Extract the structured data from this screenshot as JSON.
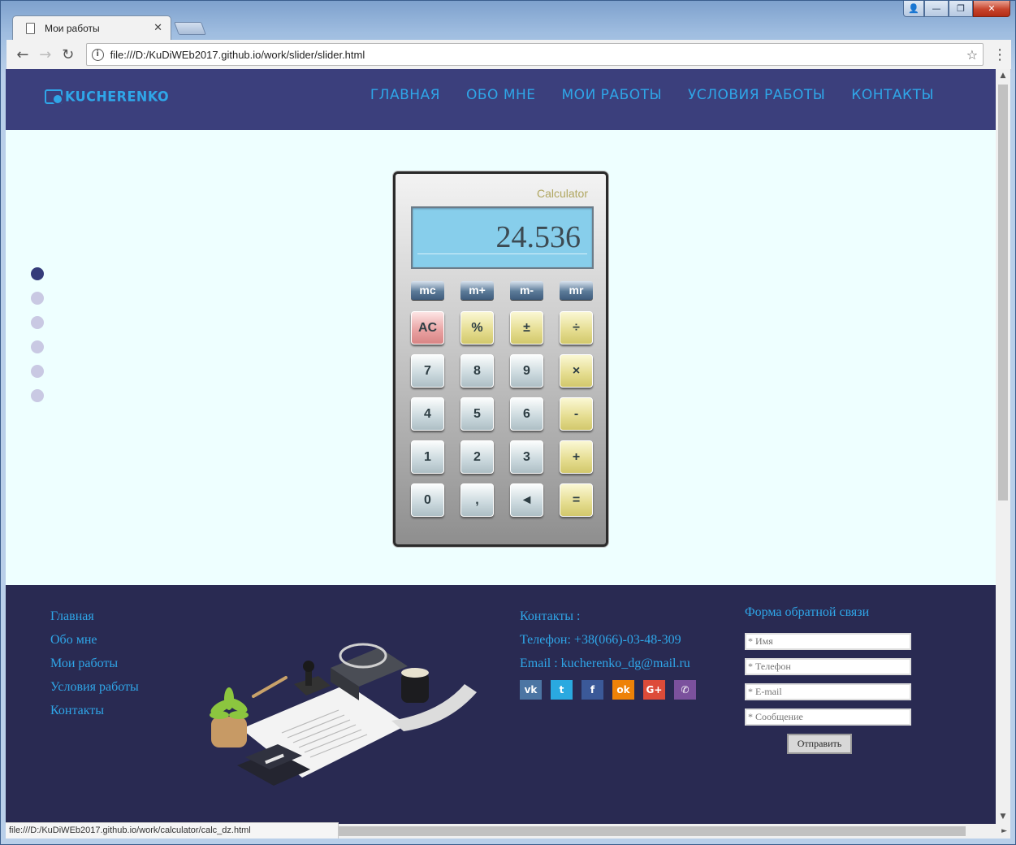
{
  "browser": {
    "tab_title": "Мои работы",
    "tab_close": "✕",
    "url": "file:///D:/KuDiWEb2017.github.io/work/slider/slider.html",
    "status_url": "file:///D:/KuDiWEb2017.github.io/work/calculator/calc_dz.html",
    "back_icon": "←",
    "forward_icon": "→",
    "reload_icon": "↻",
    "star_icon": "☆",
    "menu_icon": "⋮"
  },
  "header": {
    "logo_text": "KUCHERENKO",
    "nav": [
      "ГЛАВНАЯ",
      "ОБО МНЕ",
      "МОИ РАБОТЫ",
      "УСЛОВИЯ РАБОТЫ",
      "КОНТАКТЫ"
    ]
  },
  "slider": {
    "dot_count": 6,
    "active_index": 0
  },
  "calculator": {
    "brand": "Calculator",
    "display": "24.536",
    "memory_keys": [
      "mc",
      "m+",
      "m-",
      "mr"
    ],
    "rows": [
      [
        "AC",
        "%",
        "±",
        "÷"
      ],
      [
        "7",
        "8",
        "9",
        "×"
      ],
      [
        "4",
        "5",
        "6",
        "-"
      ],
      [
        "1",
        "2",
        "3",
        "+"
      ],
      [
        "0",
        ",",
        "◄",
        "="
      ]
    ]
  },
  "footer": {
    "nav": [
      "Главная",
      "Обо мне",
      "Мои работы",
      "Условия работы",
      "Контакты"
    ],
    "contacts_title": "Контакты :",
    "phone": "Телефон: +38(066)-03-48-309",
    "email": "Email : kucherenko_dg@mail.ru",
    "socials": [
      {
        "name": "vk",
        "label": "vk",
        "color": "#4c75a3"
      },
      {
        "name": "twitter",
        "label": "t",
        "color": "#2aa9e0"
      },
      {
        "name": "facebook",
        "label": "f",
        "color": "#3b5998"
      },
      {
        "name": "odnoklassniki",
        "label": "ok",
        "color": "#ee8208"
      },
      {
        "name": "google-plus",
        "label": "G+",
        "color": "#dd4b39"
      },
      {
        "name": "viber",
        "label": "✆",
        "color": "#7b519d"
      }
    ],
    "form": {
      "title": "Форма обратной связи",
      "name_placeholder": "* Имя",
      "phone_placeholder": "* Телефон",
      "email_placeholder": "* E-mail",
      "message_placeholder": "* Сообщение",
      "submit_label": "Отправить"
    }
  },
  "colors": {
    "header_bg": "#3b3f7c",
    "footer_bg": "#292a52",
    "accent": "#2fa6e8",
    "page_bg": "#eeffff"
  }
}
